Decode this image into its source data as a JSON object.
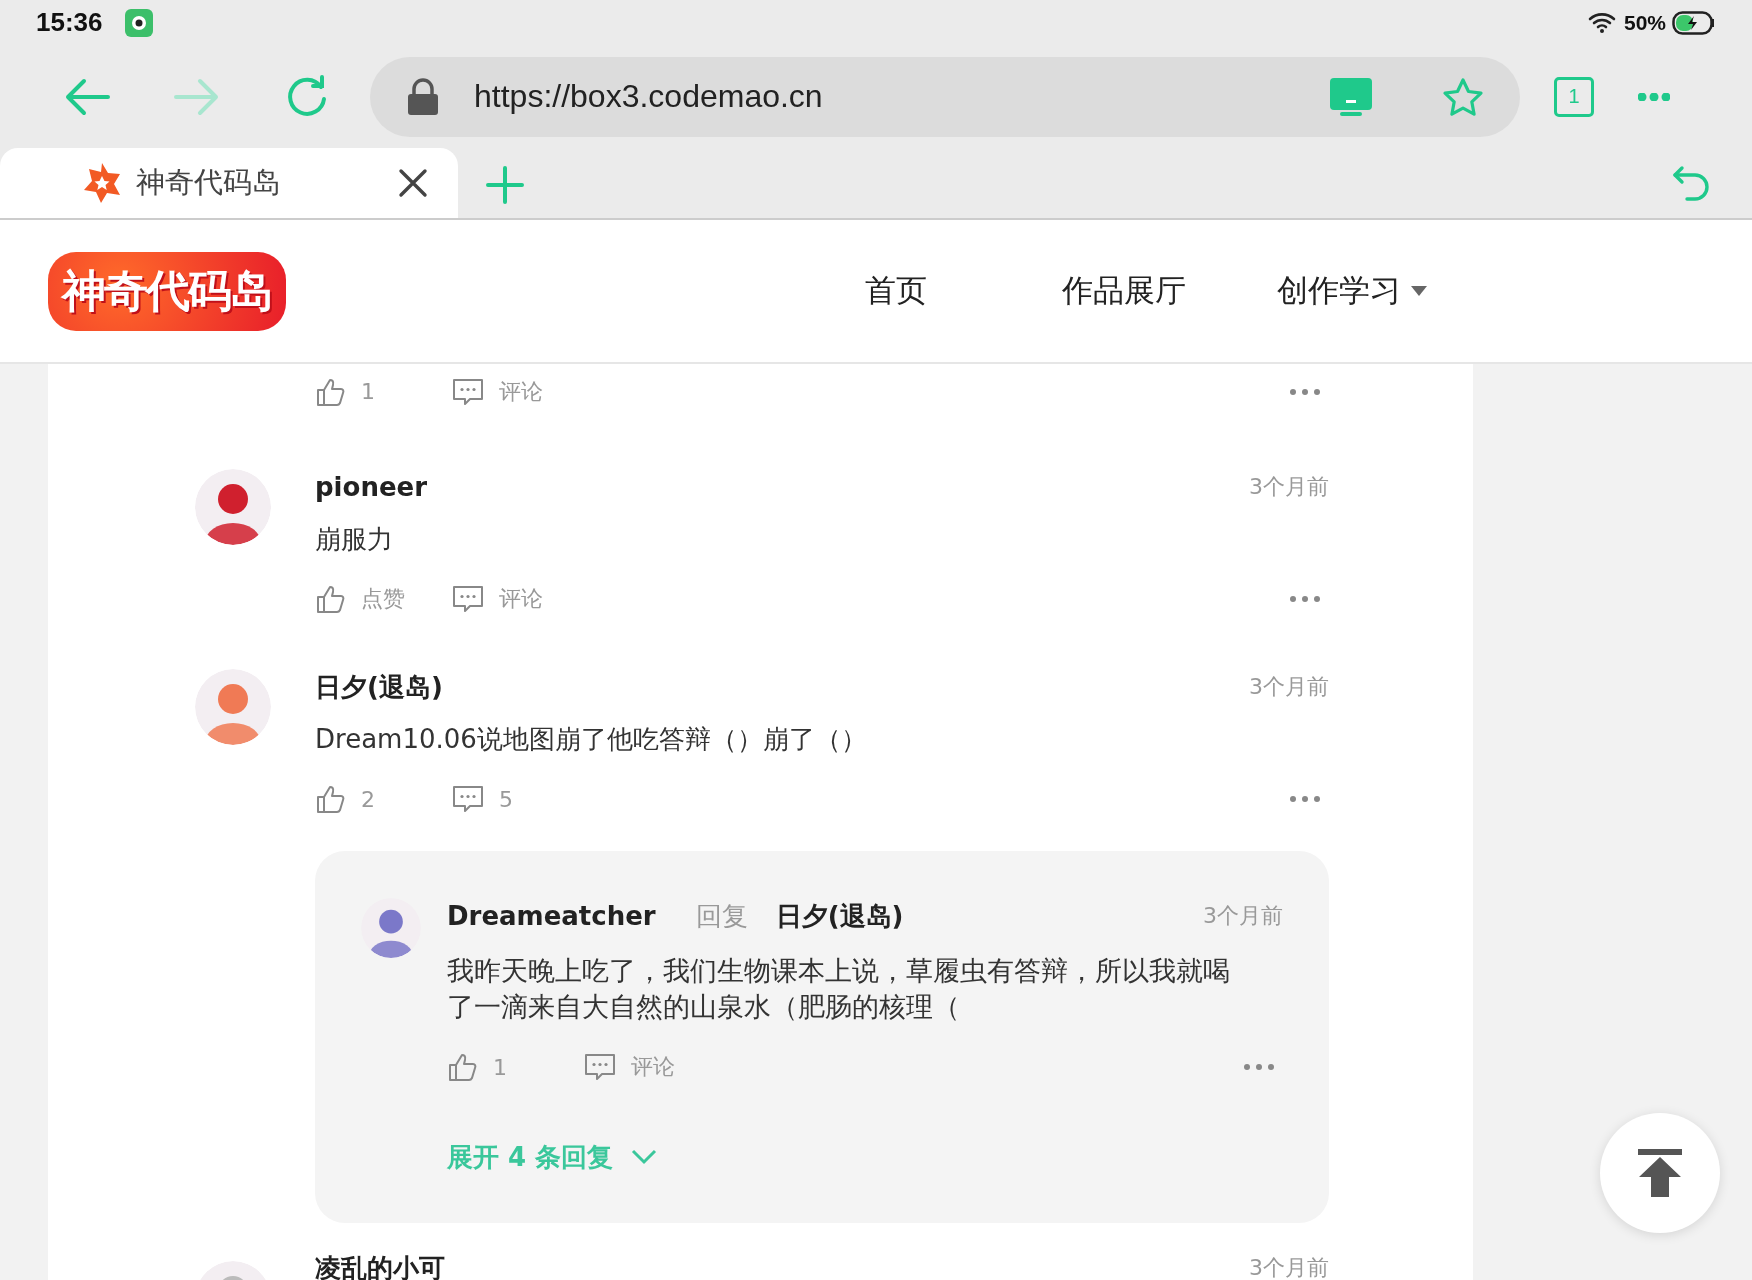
{
  "status_bar": {
    "time": "15:36",
    "battery": "50%"
  },
  "browser": {
    "nav_buttons": [
      {
        "kind": "back",
        "disabled": false
      },
      {
        "kind": "forward",
        "disabled": true
      },
      {
        "kind": "reload",
        "disabled": false
      }
    ],
    "url": "https://box3.codemao.cn",
    "tab_count": "1",
    "tabs": [
      {
        "title": "神奇代码岛",
        "selected": true
      }
    ]
  },
  "site": {
    "logo": "神奇代码岛",
    "nav": [
      {
        "label": "首页",
        "has_menu": false
      },
      {
        "label": "作品展厅",
        "has_menu": false
      },
      {
        "label": "创作学习",
        "has_menu": true
      }
    ]
  },
  "comments": [
    {
      "kind": "tail",
      "likes": "1",
      "comment_label": "评论"
    },
    {
      "kind": "full",
      "user": "pioneer",
      "time": "3个月前",
      "text": "崩服力",
      "likes": "点赞",
      "comment_label": "评论"
    },
    {
      "kind": "full",
      "user": "日夕(退岛)",
      "time": "3个月前",
      "text": "Dream10.06说地图崩了他吃答辩（）崩了（）",
      "likes": "2",
      "comment_label": "5",
      "replies": [
        {
          "user": "Dreameatcher",
          "reply_word": "回复",
          "reply_to": "日夕(退岛)",
          "time": "3个月前",
          "text": "我昨天晚上吃了，我们生物课本上说，草履虫有答辩，所以我就喝了一滴来自大自然的山泉水（肥肠的核理（",
          "likes": "1",
          "comment_label": "评论"
        }
      ],
      "expand_label": "展开 4 条回复"
    },
    {
      "kind": "cut",
      "user": "凌乱的小可",
      "time": "3个月前"
    }
  ]
}
